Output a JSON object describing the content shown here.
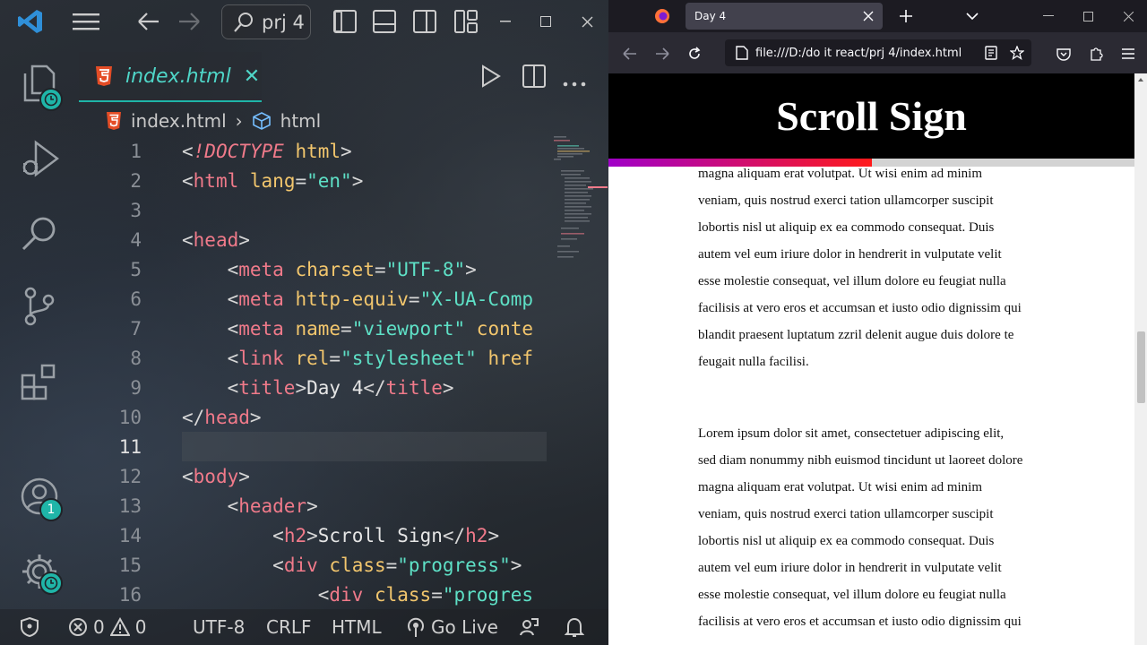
{
  "vscode": {
    "search": "prj 4",
    "tab": {
      "label": "index.html",
      "close": "✕"
    },
    "breadcrumb": {
      "file": "index.html",
      "symbol": "html",
      "sep": "›"
    },
    "active_line": 11,
    "lines": [
      {
        "n": "1",
        "code": "<!DOCTYPE html>"
      },
      {
        "n": "2",
        "code": "<html lang=\"en\">"
      },
      {
        "n": "3",
        "code": ""
      },
      {
        "n": "4",
        "code": "<head>"
      },
      {
        "n": "5",
        "code": "    <meta charset=\"UTF-8\">"
      },
      {
        "n": "6",
        "code": "    <meta http-equiv=\"X-UA-Comp"
      },
      {
        "n": "7",
        "code": "    <meta name=\"viewport\" conte"
      },
      {
        "n": "8",
        "code": "    <link rel=\"stylesheet\" href"
      },
      {
        "n": "9",
        "code": "    <title>Day 4</title>"
      },
      {
        "n": "10",
        "code": "</head>"
      },
      {
        "n": "11",
        "code": ""
      },
      {
        "n": "12",
        "code": "<body>"
      },
      {
        "n": "13",
        "code": "    <header>"
      },
      {
        "n": "14",
        "code": "        <h2>Scroll Sign</h2>"
      },
      {
        "n": "15",
        "code": "        <div class=\"progress\">"
      },
      {
        "n": "16",
        "code": "            <div class=\"progres"
      }
    ],
    "accounts_badge": "1",
    "status": {
      "errors": "0",
      "warnings": "0",
      "encoding": "UTF-8",
      "eol": "CRLF",
      "language": "HTML",
      "golive": "Go Live"
    },
    "colors": {
      "accent": "#1fb5a8",
      "tag": "#f07a8a",
      "attr": "#f2c66d",
      "string": "#5ee0c6"
    }
  },
  "firefox": {
    "tab_title": "Day 4",
    "url": "file:///D:/do it react/prj 4/index.html",
    "page": {
      "heading": "Scroll Sign",
      "progress": 0.5,
      "para1_lines": [
        "magna aliquam erat volutpat. Ut wisi enim ad minim",
        "veniam, quis nostrud exerci tation ullamcorper suscipit",
        "lobortis nisl ut aliquip ex ea commodo consequat. Duis",
        "autem vel eum iriure dolor in hendrerit in vulputate velit",
        "esse molestie consequat, vel illum dolore eu feugiat nulla",
        "facilisis at vero eros et accumsan et iusto odio dignissim qui",
        "blandit praesent luptatum zzril delenit augue duis dolore te",
        "feugait nulla facilisi."
      ],
      "para2_lines": [
        "Lorem ipsum dolor sit amet, consectetuer adipiscing elit,",
        "sed diam nonummy nibh euismod tincidunt ut laoreet dolore",
        "magna aliquam erat volutpat. Ut wisi enim ad minim",
        "veniam, quis nostrud exerci tation ullamcorper suscipit",
        "lobortis nisl ut aliquip ex ea commodo consequat. Duis",
        "autem vel eum iriure dolor in hendrerit in vulputate velit",
        "esse molestie consequat, vel illum dolore eu feugiat nulla",
        "facilisis at vero eros et accumsan et iusto odio dignissim qui"
      ]
    }
  }
}
